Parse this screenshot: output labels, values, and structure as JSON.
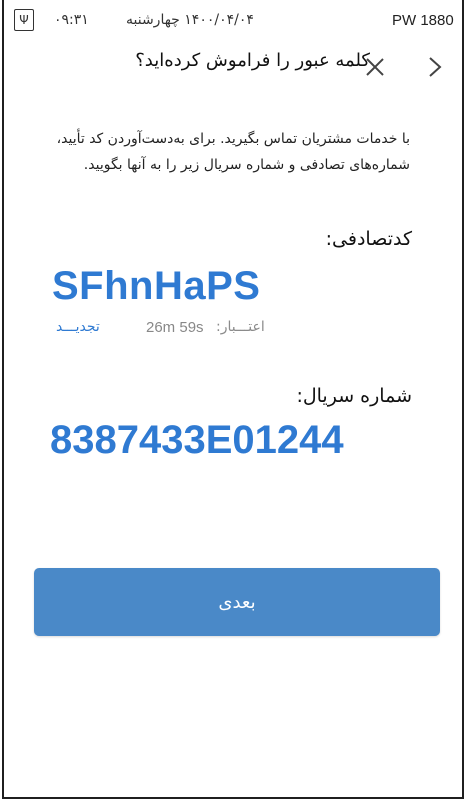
{
  "status_bar": {
    "device": "PW 1880",
    "date": "۱۴۰۰/۰۴/۰۴ چهارشنبه",
    "time": "۰۹:۳۱",
    "sim_icon": "sim-icon"
  },
  "header": {
    "title": "کلمه عبور را فراموش کرده‌اید؟",
    "close_icon": "close-icon",
    "back_icon": "chevron-right-icon"
  },
  "instructions": "با خدمات مشتریان تماس بگیرید. برای به‌دست‌آوردن کد تأیید، شماره‌های تصادفی و شماره سریال زیر را به آنها بگویید.",
  "random_code": {
    "label": "کدتصادفی:",
    "value": "SFhnHaPS",
    "validity_label": "اعتـــبار:",
    "validity_time": "26m 59s",
    "refresh_label": "تجدیـــد"
  },
  "serial": {
    "label": "شماره سریال:",
    "value": "8387433E01244"
  },
  "next_button": {
    "label": "بعدی"
  },
  "colors": {
    "accent": "#2f7ad2",
    "button": "#4a89c8"
  }
}
